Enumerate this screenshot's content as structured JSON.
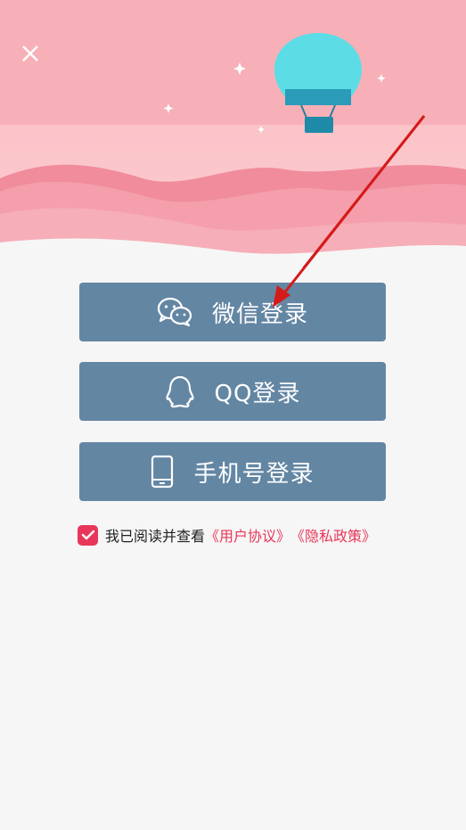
{
  "colors": {
    "accent": "#e8365a",
    "button_bg": "#6386a3",
    "page_bg": "#f6f6f6"
  },
  "login": {
    "wechat_label": "微信登录",
    "qq_label": "QQ登录",
    "phone_label": "手机号登录"
  },
  "agreement": {
    "checked": true,
    "prefix": "我已阅读并查看",
    "user_agreement": "《用户协议》",
    "privacy_policy": "《隐私政策》"
  },
  "icons": [
    "close-icon",
    "balloon-icon",
    "wechat-icon",
    "qq-icon",
    "phone-icon",
    "checkmark-icon",
    "annotation-arrow"
  ]
}
